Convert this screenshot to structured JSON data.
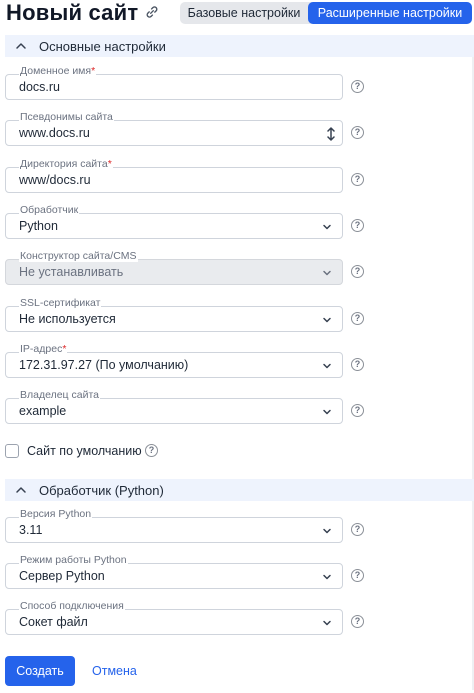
{
  "header": {
    "title": "Новый сайт",
    "tabs": [
      "Базовые настройки",
      "Расширенные настройки"
    ],
    "active_tab": "Расширенные настройки"
  },
  "sections": {
    "basic": "Основные настройки",
    "handler": "Обработчик (Python)"
  },
  "fields": {
    "domain": {
      "label": "Доменное имя",
      "value": "docs.ru",
      "required": "*"
    },
    "aliases": {
      "label": "Псевдонимы сайта",
      "value": "www.docs.ru"
    },
    "directory": {
      "label": "Директория сайта",
      "value": "www/docs.ru",
      "required": "*"
    },
    "handler": {
      "label": "Обработчик",
      "value": "Python"
    },
    "cms": {
      "label": "Конструктор сайта/CMS",
      "value": "Не устанавливать"
    },
    "ssl": {
      "label": "SSL-сертификат",
      "value": "Не используется"
    },
    "ip": {
      "label": "IP-адрес",
      "value": "172.31.97.27 (По умолчанию)",
      "required": "*"
    },
    "owner": {
      "label": "Владелец сайта",
      "value": "example"
    },
    "python_version": {
      "label": "Версия Python",
      "value": "3.11"
    },
    "python_mode": {
      "label": "Режим работы Python",
      "value": "Сервер Python"
    },
    "connection": {
      "label": "Способ подключения",
      "value": "Сокет файл"
    }
  },
  "default_site": {
    "label": "Сайт по умолчанию",
    "checked": false
  },
  "help_glyph": "?",
  "footer": {
    "create": "Создать",
    "cancel": "Отмена"
  },
  "colors": {
    "accent": "#2563eb",
    "section_bg": "#eef3fd",
    "required": "#dc2626"
  },
  "icons": {
    "link": "link-icon",
    "collapse": "chevron-up-icon",
    "select": "chevron-down-icon",
    "resize": "resize-icon",
    "help": "help-icon"
  }
}
